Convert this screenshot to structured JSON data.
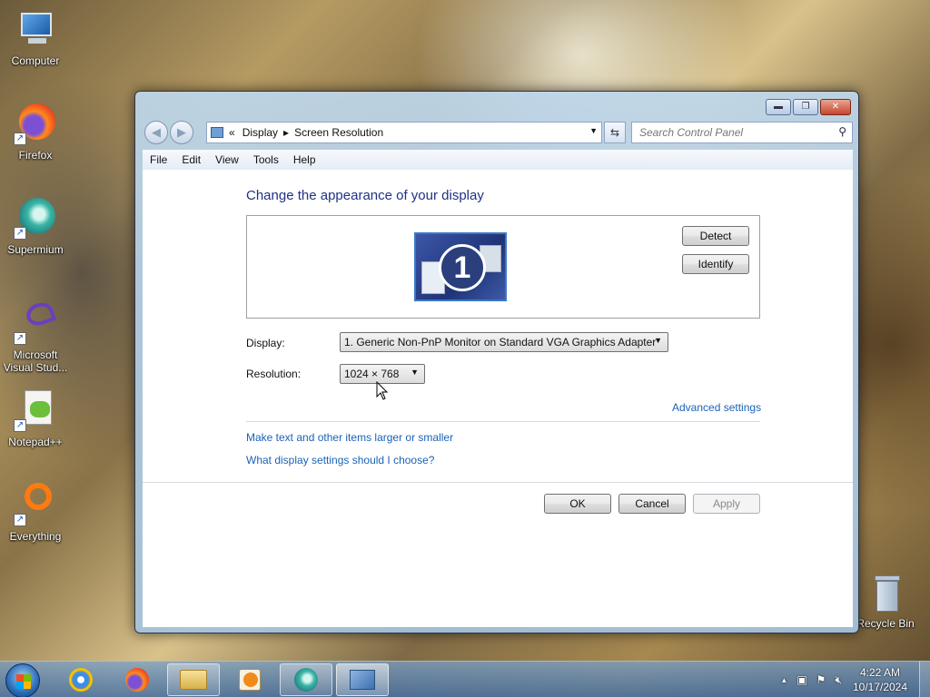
{
  "desktop": {
    "icons": [
      {
        "label": "Computer",
        "icon": "computer-icon"
      },
      {
        "label": "Firefox",
        "icon": "firefox-icon"
      },
      {
        "label": "Supermium",
        "icon": "supermium-icon"
      },
      {
        "label": "Microsoft Visual Stud...",
        "icon": "visual-studio-icon"
      },
      {
        "label": "Notepad++",
        "icon": "notepadpp-icon"
      },
      {
        "label": "Everything",
        "icon": "everything-icon"
      },
      {
        "label": "Recycle Bin",
        "icon": "recycle-bin-icon"
      }
    ]
  },
  "window": {
    "controls": {
      "minimize": "▬",
      "maximize": "❐",
      "close": "✕"
    },
    "nav": {
      "back": "◀",
      "forward": "▶"
    },
    "address": {
      "prefix": "«",
      "crumb1": "Display",
      "sep": "▸",
      "crumb2": "Screen Resolution",
      "dropdown": "▼"
    },
    "refresh": "⇆",
    "search": {
      "placeholder": "Search Control Panel",
      "icon": "⚲"
    },
    "menu": [
      "File",
      "Edit",
      "View",
      "Tools",
      "Help"
    ],
    "heading": "Change the appearance of your display",
    "monitor_number": "1",
    "detect_label": "Detect",
    "identify_label": "Identify",
    "display_label": "Display:",
    "display_value": "1. Generic Non-PnP Monitor on Standard VGA Graphics Adapter",
    "resolution_label": "Resolution:",
    "resolution_value": "1024 × 768",
    "advanced_link": "Advanced settings",
    "link_text_size": "Make text and other items larger or smaller",
    "link_which_settings": "What display settings should I choose?",
    "ok_label": "OK",
    "cancel_label": "Cancel",
    "apply_label": "Apply"
  },
  "taskbar": {
    "tray_arrow": "▲",
    "clock_time": "4:22 AM",
    "clock_date": "10/17/2024"
  },
  "colors": {
    "heading": "#1e3287",
    "link": "#1a63b6"
  }
}
